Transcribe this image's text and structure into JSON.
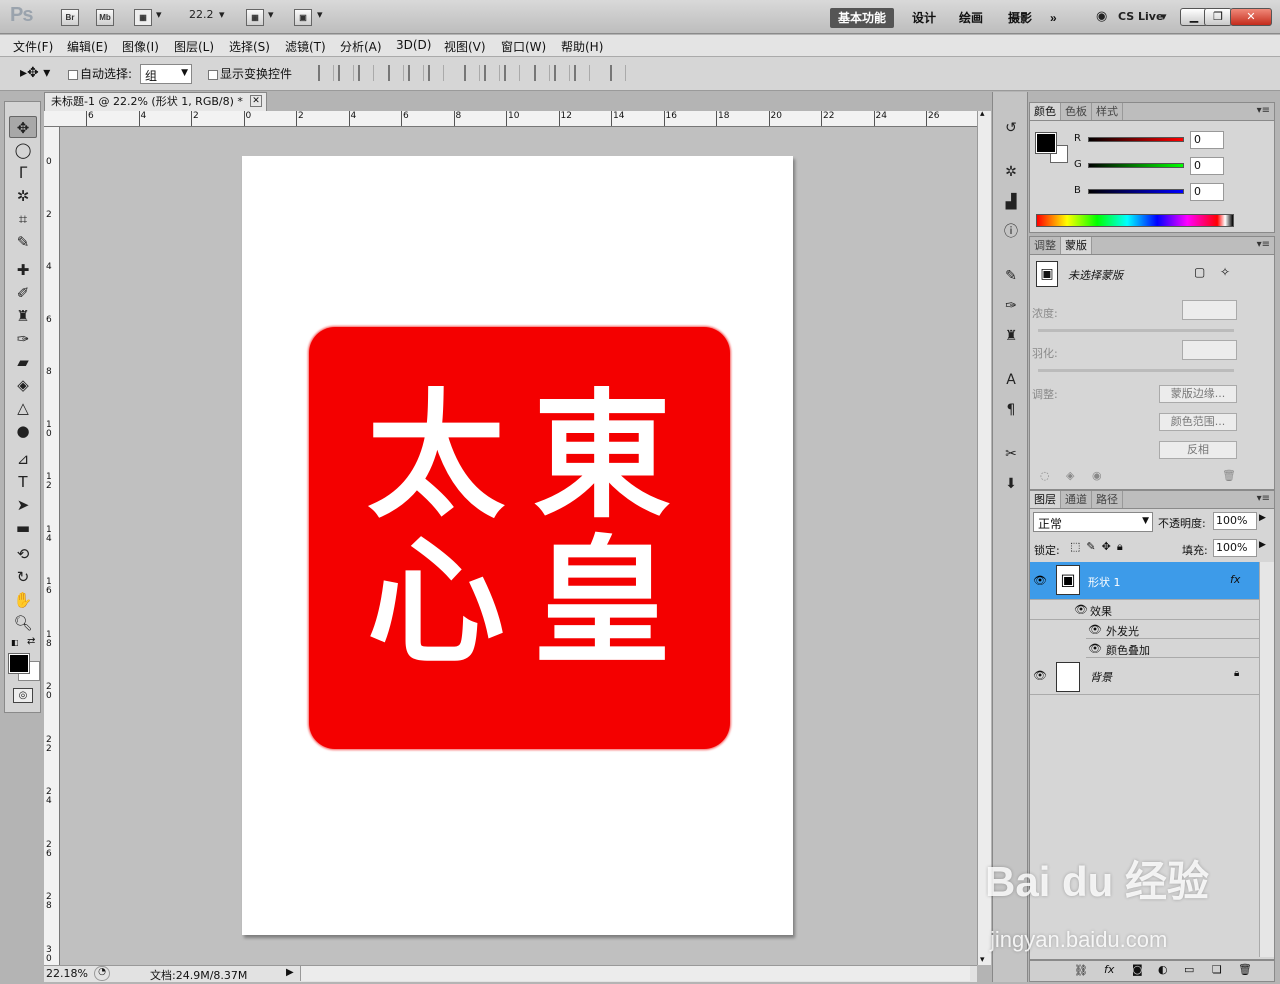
{
  "app": {
    "logo": "Ps",
    "br": "Br",
    "mb": "Mb",
    "zoom_select": "22.2",
    "cslive": "CS Live"
  },
  "workspaces": [
    {
      "label": "基本功能",
      "active": true
    },
    {
      "label": "设计"
    },
    {
      "label": "绘画"
    },
    {
      "label": "摄影"
    },
    {
      "label": "»"
    }
  ],
  "menu": [
    "文件(F)",
    "编辑(E)",
    "图像(I)",
    "图层(L)",
    "选择(S)",
    "滤镜(T)",
    "分析(A)",
    "3D(D)",
    "视图(V)",
    "窗口(W)",
    "帮助(H)"
  ],
  "options": {
    "auto_select_label": "自动选择:",
    "auto_select_value": "组",
    "show_transform_label": "显示变换控件"
  },
  "document": {
    "tab_title": "未标题-1 @ 22.2% (形状 1, RGB/8) *",
    "seal_chars": [
      "東",
      "皇",
      "太",
      "心"
    ],
    "ruler_top": [
      "6",
      "4",
      "2",
      "0",
      "2",
      "4",
      "6",
      "8",
      "10",
      "12",
      "14",
      "16",
      "18",
      "20",
      "22",
      "24",
      "26"
    ],
    "ruler_left": [
      "0",
      "2",
      "4",
      "6",
      "8",
      "10",
      "12",
      "14",
      "16",
      "18",
      "20",
      "22",
      "24",
      "26",
      "28",
      "30"
    ]
  },
  "status": {
    "zoom": "22.18%",
    "doc": "文档:24.9M/8.37M"
  },
  "color_panel": {
    "tabs": [
      "颜色",
      "色板",
      "样式"
    ],
    "channels": [
      {
        "name": "R",
        "value": "0",
        "color": "#d00000"
      },
      {
        "name": "G",
        "value": "0",
        "color": "#00b000"
      },
      {
        "name": "B",
        "value": "0",
        "color": "#0000d0"
      }
    ]
  },
  "mask_panel": {
    "tabs": [
      "调整",
      "蒙版"
    ],
    "title": "未选择蒙版",
    "density": "浓度:",
    "feather": "羽化:",
    "refine": "调整:",
    "btn_edge": "蒙版边缘...",
    "btn_range": "颜色范围...",
    "btn_invert": "反相"
  },
  "layers_panel": {
    "tabs": [
      "图层",
      "通道",
      "路径"
    ],
    "blend": "正常",
    "opacity_label": "不透明度:",
    "opacity": "100%",
    "lock_label": "锁定:",
    "fill_label": "填充:",
    "fill": "100%",
    "layers": [
      {
        "name": "形状 1",
        "fx": "fx"
      },
      {
        "name": "效果"
      },
      {
        "name": "外发光"
      },
      {
        "name": "颜色叠加"
      },
      {
        "name": "背景"
      }
    ]
  },
  "watermark": {
    "line1": "Bai du 经验",
    "line2": "jingyan.baidu.com"
  }
}
